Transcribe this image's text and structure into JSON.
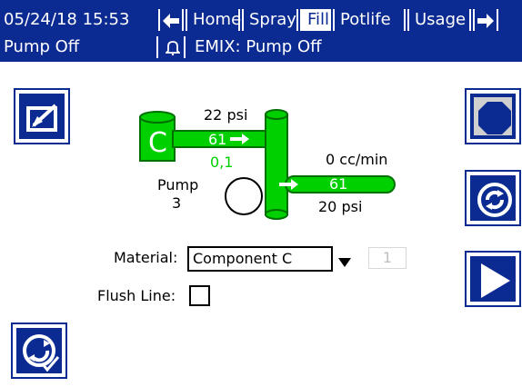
{
  "header": {
    "datetime": "05/24/18 15:53",
    "tabs": [
      {
        "label": "Home"
      },
      {
        "label": "Spray"
      },
      {
        "label": "Fill"
      },
      {
        "label": "Potlife"
      },
      {
        "label": "Usage"
      }
    ],
    "status_left": "Pump Off",
    "status_right": "EMIX: Pump Off",
    "left_arrow_icon": "left-arrow-icon",
    "right_arrow_icon": "right-arrow-icon",
    "bell_icon": "bell-icon"
  },
  "left_buttons": {
    "edit_icon": "edit-icon",
    "refresh_check_icon": "refresh-check-icon"
  },
  "right_buttons": {
    "stop_icon": "stop-icon",
    "refresh_icon": "refresh-icon",
    "play_icon": "play-icon"
  },
  "diagram": {
    "component_letter": "C",
    "pressure_top": "22 psi",
    "pump_flow_value": "61",
    "pump_secondary_value": "0,1",
    "pump_label": "Pump",
    "pump_number": "3",
    "flow_rate": "0 cc/min",
    "output_value": "61",
    "pressure_bottom": "20 psi"
  },
  "form": {
    "material_label": "Material:",
    "material_value": "Component C",
    "material_index": "1",
    "flush_label": "Flush Line:"
  },
  "colors": {
    "primary_blue": "#0b2b93",
    "green": "#00d000",
    "white": "#ffffff",
    "black": "#000000",
    "stop_gray": "#cfcfcf"
  }
}
